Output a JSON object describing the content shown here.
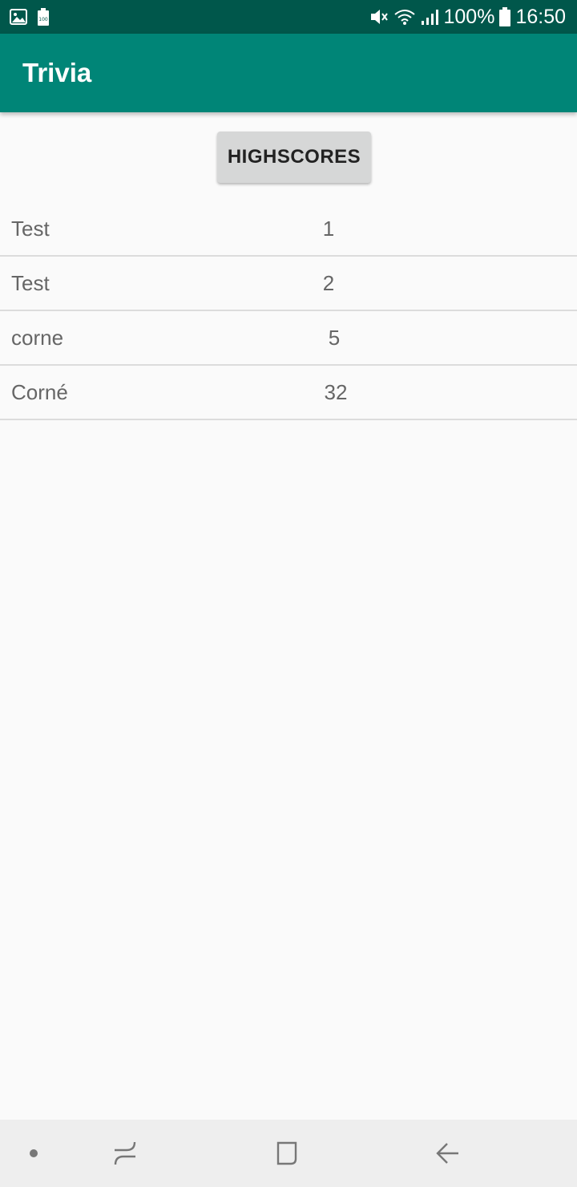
{
  "status_bar": {
    "battery_percent": "100%",
    "time": "16:50",
    "left_icons": [
      "image-icon",
      "battery-saver-icon"
    ],
    "right_icons": [
      "mute-icon",
      "wifi-icon",
      "signal-icon",
      "battery-icon"
    ]
  },
  "app_bar": {
    "title": "Trivia"
  },
  "main": {
    "highscores_button": "HIGHSCORES",
    "rows": [
      {
        "name": "Test",
        "score": "1"
      },
      {
        "name": "Test",
        "score": "2"
      },
      {
        "name": "corne",
        "score": "5"
      },
      {
        "name": "Corné",
        "score": "32"
      }
    ]
  },
  "nav_bar": {
    "icons": [
      "dot-icon",
      "recent-apps-icon",
      "home-icon",
      "back-icon"
    ]
  },
  "colors": {
    "status_bar": "#00574b",
    "app_bar": "#008577",
    "background": "#fafafa",
    "button": "#d6d7d7"
  }
}
